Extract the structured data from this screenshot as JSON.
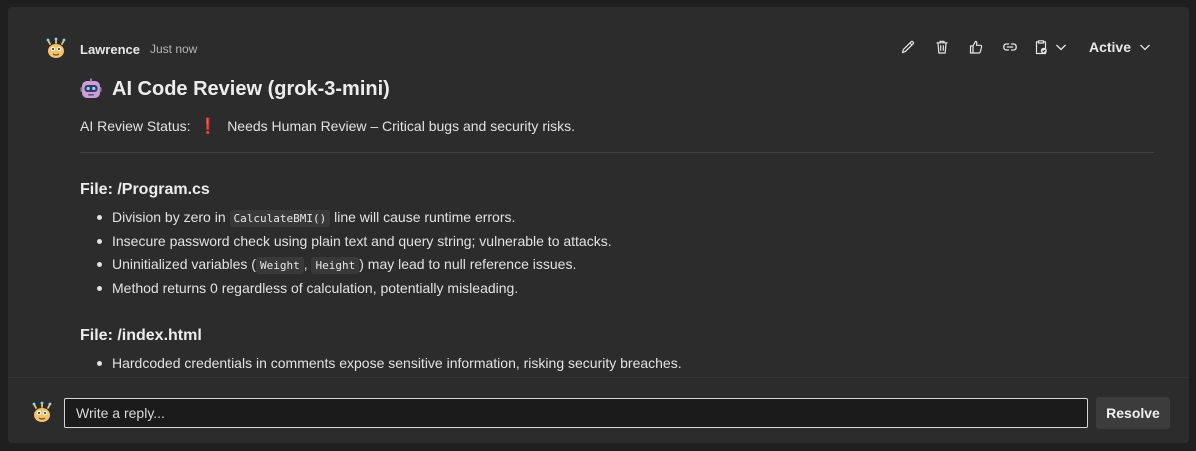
{
  "comment": {
    "author": "Lawrence",
    "timestamp": "Just now",
    "avatar_icon": "bug-mascot-avatar",
    "title": "AI Code Review (grok-3-mini)",
    "title_icon": "robot-icon",
    "review_status_label": "AI Review Status:",
    "review_status_icon": "❗",
    "review_status_text": "Needs Human Review – Critical bugs and security risks."
  },
  "toolbar": {
    "icons": [
      "edit-icon",
      "delete-icon",
      "like-icon",
      "link-icon",
      "clipboard-icon"
    ],
    "status_value": "Active"
  },
  "files": [
    {
      "heading": "File: /Program.cs",
      "issues": [
        {
          "pre": "Division by zero in ",
          "code": [
            "CalculateBMI()"
          ],
          "post": " line will cause runtime errors."
        },
        {
          "pre": "Insecure password check using plain text and query string; vulnerable to attacks.",
          "code": [],
          "post": ""
        },
        {
          "pre": "Uninitialized variables (",
          "code": [
            "Weight",
            "Height"
          ],
          "sep": ", ",
          "post": ") may lead to null reference issues."
        },
        {
          "pre": "Method returns 0 regardless of calculation, potentially misleading.",
          "code": [],
          "post": ""
        }
      ]
    },
    {
      "heading": "File: /index.html",
      "issues": [
        {
          "pre": "Hardcoded credentials in comments expose sensitive information, risking security breaches.",
          "code": [],
          "post": ""
        }
      ]
    }
  ],
  "reply": {
    "placeholder": "Write a reply...",
    "resolve_label": "Resolve"
  },
  "colors": {
    "background": "#1f1f1f",
    "card": "#2d2c2c",
    "alert": "#e04646"
  }
}
